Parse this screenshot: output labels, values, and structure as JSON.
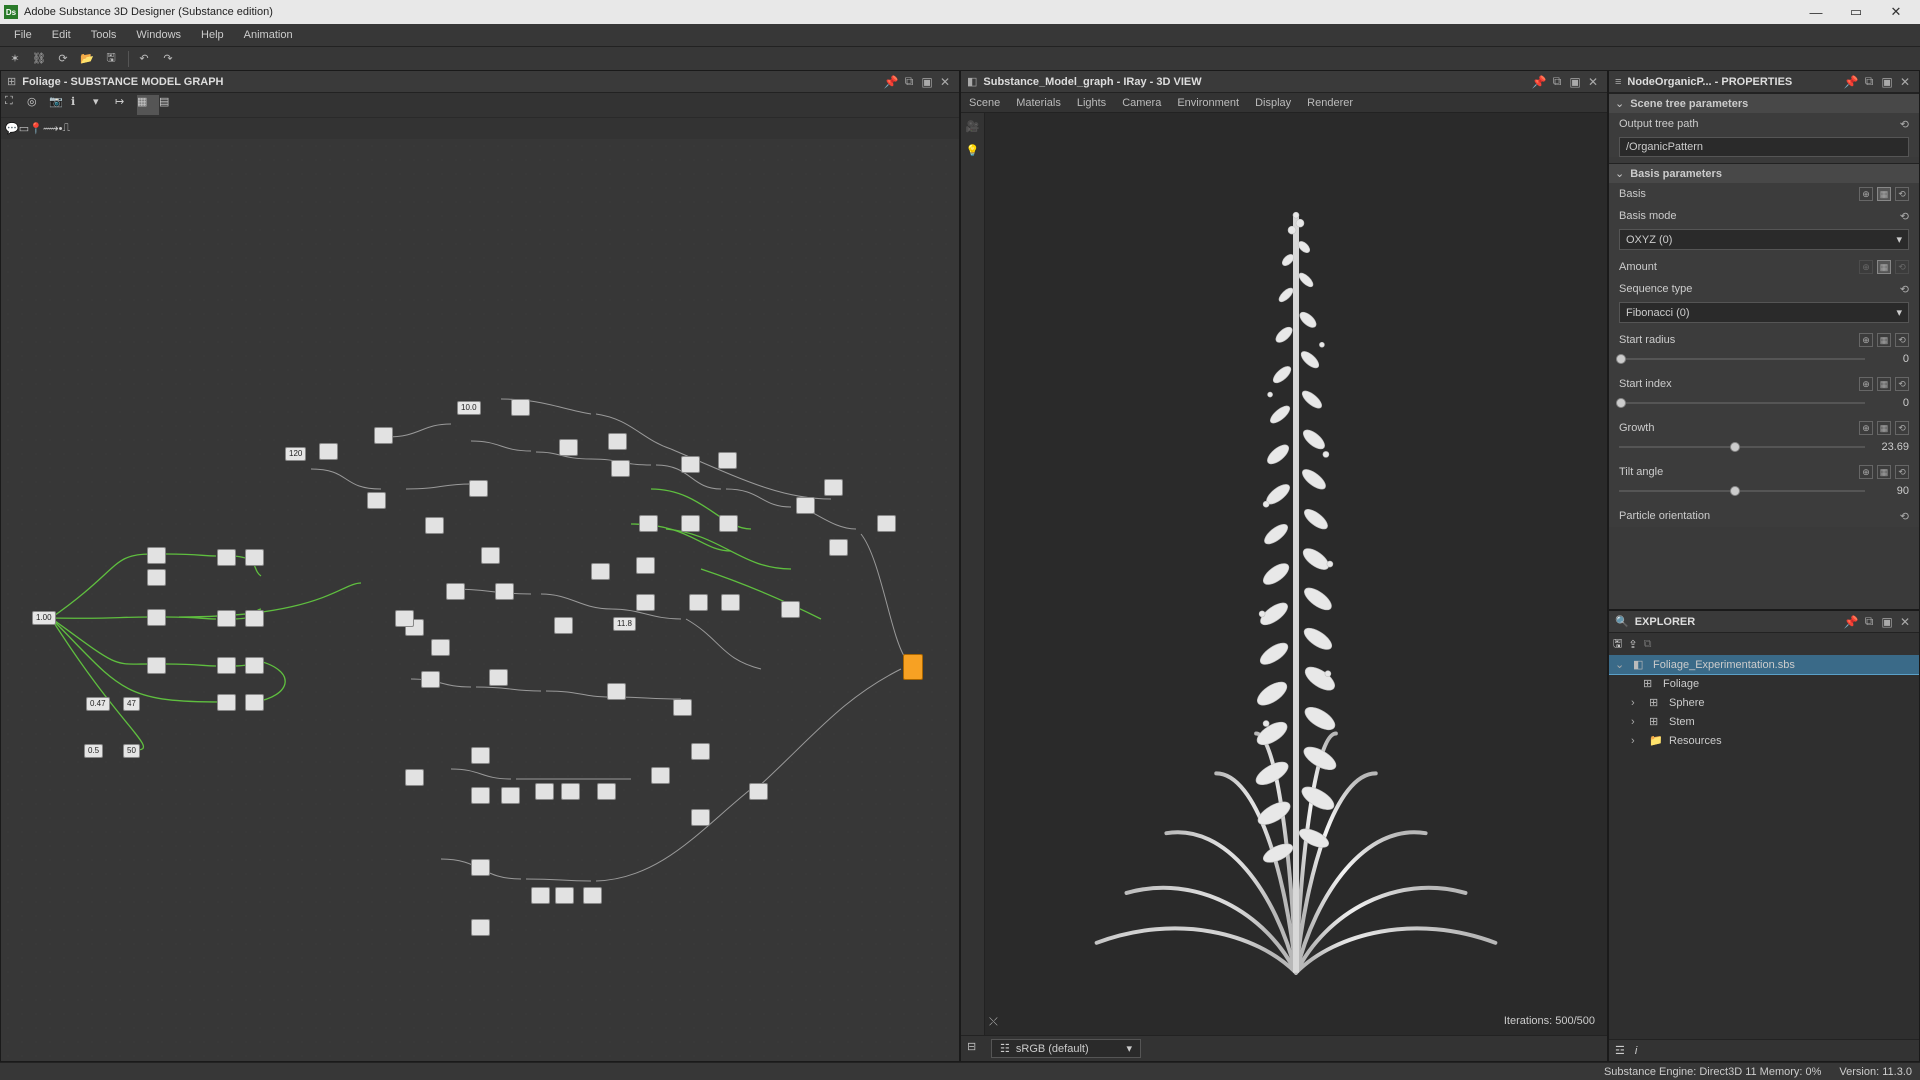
{
  "window": {
    "title": "Adobe Substance 3D Designer (Substance edition)"
  },
  "menu": [
    "File",
    "Edit",
    "Tools",
    "Windows",
    "Help",
    "Animation"
  ],
  "graph_panel": {
    "title": "Foliage - SUBSTANCE MODEL GRAPH"
  },
  "viewer_panel": {
    "title": "Substance_Model_graph - IRay - 3D VIEW",
    "tabs": [
      "Scene",
      "Materials",
      "Lights",
      "Camera",
      "Environment",
      "Display",
      "Renderer"
    ],
    "iterations": "Iterations: 500/500",
    "color_space": "sRGB (default)"
  },
  "properties_panel": {
    "title": "NodeOrganicP... - PROPERTIES",
    "sections": {
      "scene_tree": {
        "header": "Scene tree parameters",
        "output_label": "Output tree path",
        "output_value": "/OrganicPattern"
      },
      "basis": {
        "header": "Basis parameters",
        "basis_label": "Basis",
        "basis_mode_label": "Basis mode",
        "basis_mode_value": "OXYZ (0)",
        "amount_label": "Amount",
        "sequence_label": "Sequence type",
        "sequence_value": "Fibonacci (0)",
        "start_radius_label": "Start radius",
        "start_radius_value": "0",
        "start_index_label": "Start index",
        "start_index_value": "0",
        "growth_label": "Growth",
        "growth_value": "23.69",
        "tilt_label": "Tilt angle",
        "tilt_value": "90",
        "particle_orient_label": "Particle orientation"
      }
    }
  },
  "explorer_panel": {
    "title": "EXPLORER",
    "root": "Foliage_Experimentation.sbs",
    "items": [
      "Foliage",
      "Sphere",
      "Stem",
      "Resources"
    ]
  },
  "node_vals": {
    "v1": "1.00",
    "v2": "0.47",
    "v3": "47",
    "v4": "0.5",
    "v5": "50",
    "v6": "10.0",
    "v7": "120",
    "v8": "11.8"
  },
  "status": {
    "engine": "Substance Engine: Direct3D 11 Memory: 0%",
    "version": "Version: 11.3.0"
  }
}
